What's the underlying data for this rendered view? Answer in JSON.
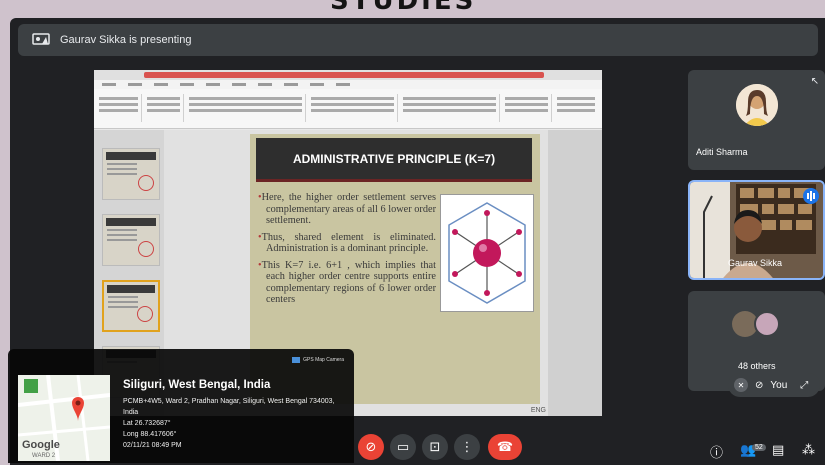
{
  "overlay_title": "STUDIES",
  "meet": {
    "presenter_text": "Gaurav Sikka is presenting",
    "participants": [
      {
        "name": "Aditi Sharma"
      },
      {
        "name": "Gaurav Sikka"
      },
      {
        "name": "48 others"
      }
    ],
    "you_label": "You",
    "people_count": "52"
  },
  "slide": {
    "title": "ADMINISTRATIVE PRINCIPLE (K=7)",
    "bullets": [
      "Here, the higher order settlement serves complementary areas of all 6 lower order settlement.",
      "Thus, shared element is eliminated. Administration is a dominant principle.",
      "This K=7 i.e. 6+1 , which implies that each higher order centre supports entire complementary regions of 6 lower order centers"
    ],
    "status_text": "ENG"
  },
  "gps": {
    "tag": "GPS Map Camera",
    "map_brand": "Google",
    "map_label": "WARD 2",
    "city": "Siliguri, West Bengal, India",
    "address": "PCMB+4W5, Ward 2, Pradhan Nagar, Siliguri, West Bengal 734003, India",
    "lat": "Lat 26.732687°",
    "long": "Long 88.417606°",
    "datetime": "02/11/21  08:49 PM"
  },
  "colors": {
    "meet_bg": "#202124",
    "tile_bg": "#3c4043",
    "end_call": "#ea4335",
    "accent_blue": "#1a73e8",
    "slide_bg": "#c9c5a1"
  }
}
